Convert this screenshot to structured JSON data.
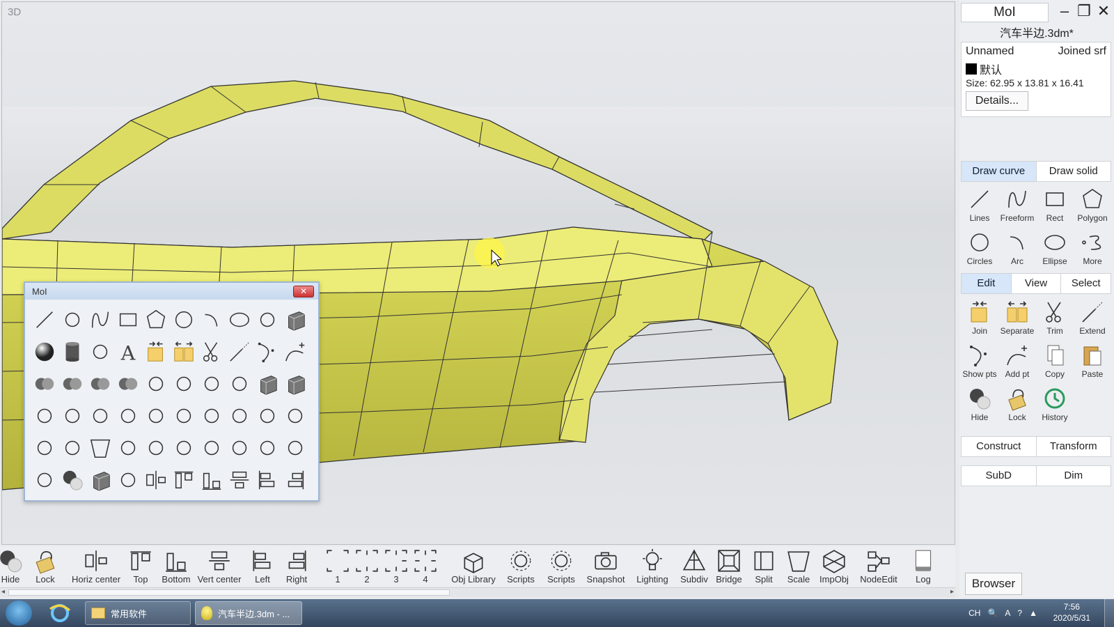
{
  "viewport": {
    "label": "3D"
  },
  "palette": {
    "title": "MoI",
    "close_symbol": "✕"
  },
  "panel": {
    "app_title": "MoI",
    "document_name": "汽车半边.3dm*",
    "object": {
      "name": "Unnamed",
      "type": "Joined srf",
      "style": "默认",
      "style_color": "#000000",
      "size": "Size: 62.95 x 13.81 x 16.41",
      "details_label": "Details..."
    },
    "draw_tabs": [
      "Draw curve",
      "Draw solid"
    ],
    "draw_tools": [
      {
        "label": "Lines",
        "icon": "line-icon"
      },
      {
        "label": "Freeform",
        "icon": "freeform-icon"
      },
      {
        "label": "Rect",
        "icon": "rectangle-icon"
      },
      {
        "label": "Polygon",
        "icon": "polygon-icon"
      },
      {
        "label": "Circles",
        "icon": "circle-icon"
      },
      {
        "label": "Arc",
        "icon": "arc-icon"
      },
      {
        "label": "Ellipse",
        "icon": "ellipse-icon"
      },
      {
        "label": "More",
        "icon": "more-icon"
      }
    ],
    "edit_tabs": [
      "Edit",
      "View",
      "Select"
    ],
    "edit_tools": [
      {
        "label": "Join",
        "icon": "join-icon"
      },
      {
        "label": "Separate",
        "icon": "separate-icon"
      },
      {
        "label": "Trim",
        "icon": "scissors-icon"
      },
      {
        "label": "Extend",
        "icon": "extend-icon"
      },
      {
        "label": "Show pts",
        "icon": "show-points-icon"
      },
      {
        "label": "Add pt",
        "icon": "add-point-icon"
      },
      {
        "label": "Copy",
        "icon": "copy-icon"
      },
      {
        "label": "Paste",
        "icon": "paste-icon"
      },
      {
        "label": "Hide",
        "icon": "hide-icon"
      },
      {
        "label": "Lock",
        "icon": "lock-icon"
      },
      {
        "label": "History",
        "icon": "history-icon"
      }
    ],
    "construct_tabs": [
      "Construct",
      "Transform"
    ],
    "subd_tabs": [
      "SubD",
      "Dim"
    ]
  },
  "bottom_toolbar": [
    {
      "label": "Hide",
      "icon": "hide-icon"
    },
    {
      "label": "Lock",
      "icon": "lock-icon"
    },
    {
      "label": "Horiz center",
      "icon": "align-horizontal-center-icon"
    },
    {
      "label": "Top",
      "icon": "align-top-icon"
    },
    {
      "label": "Bottom",
      "icon": "align-bottom-icon"
    },
    {
      "label": "Vert center",
      "icon": "align-vertical-center-icon"
    },
    {
      "label": "Left",
      "icon": "align-left-icon"
    },
    {
      "label": "Right",
      "icon": "align-right-icon"
    },
    {
      "label": "1",
      "icon": "viewport-layout-1-icon"
    },
    {
      "label": "2",
      "icon": "viewport-layout-2-icon"
    },
    {
      "label": "3",
      "icon": "viewport-layout-3-icon"
    },
    {
      "label": "4",
      "icon": "viewport-layout-4-icon"
    },
    {
      "label": "Obj Library",
      "icon": "object-library-icon"
    },
    {
      "label": "Scripts",
      "icon": "gear-icon"
    },
    {
      "label": "Scripts",
      "icon": "gear-icon"
    },
    {
      "label": "Snapshot",
      "icon": "camera-icon"
    },
    {
      "label": "Lighting",
      "icon": "lightbulb-icon"
    },
    {
      "label": "Subdiv",
      "icon": "subdivide-icon"
    },
    {
      "label": "Bridge",
      "icon": "bridge-icon"
    },
    {
      "label": "Split",
      "icon": "split-icon"
    },
    {
      "label": "Scale",
      "icon": "scale-icon"
    },
    {
      "label": "ImpObj",
      "icon": "import-object-icon"
    },
    {
      "label": "NodeEdit",
      "icon": "node-editor-icon"
    },
    {
      "label": "Log",
      "icon": "log-icon"
    }
  ],
  "browser_label": "Browser",
  "taskbar": {
    "tasks": [
      {
        "label": "常用软件",
        "icon": "folder-icon"
      },
      {
        "label": "汽车半边.3dm - ...",
        "icon": "moi-app-icon"
      }
    ],
    "tray_lang": "CH",
    "time": "7:56",
    "date": "2020/5/31"
  }
}
